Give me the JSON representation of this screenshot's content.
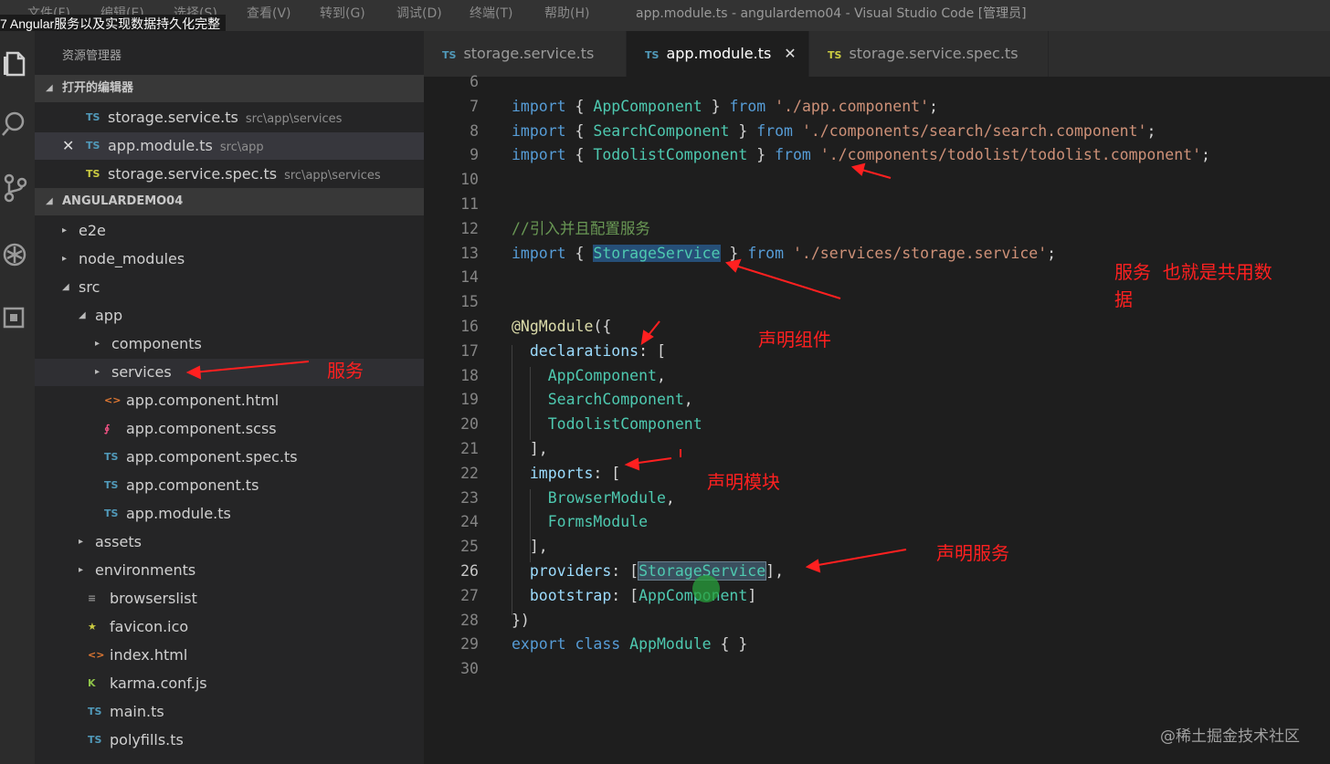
{
  "video_title": "7 Angular服务以及实现数据持久化完整",
  "titlebar": {
    "menu": [
      "文件(F)",
      "编辑(E)",
      "选择(S)",
      "查看(V)",
      "转到(G)",
      "调试(D)",
      "终端(T)",
      "帮助(H)"
    ],
    "window_title": "app.module.ts - angulardemo04 - Visual Studio Code [管理员]"
  },
  "activitybar": {
    "icons": [
      "files-icon",
      "search-icon",
      "source-control-icon",
      "debug-icon",
      "extensions-icon"
    ]
  },
  "sidebar": {
    "title": "资源管理器",
    "open_editors": {
      "header": "打开的编辑器",
      "items": [
        {
          "icon": "TS",
          "name": "storage.service.ts",
          "path": "src\\app\\services"
        },
        {
          "icon": "TS",
          "name": "app.module.ts",
          "path": "src\\app",
          "close": "✕"
        },
        {
          "icon": "TS",
          "name": "storage.service.spec.ts",
          "path": "src\\app\\services"
        }
      ]
    },
    "project": {
      "header": "ANGULARDEMO04",
      "tree": [
        {
          "name": "e2e",
          "icon": "▸",
          "indent": 0,
          "folder": true
        },
        {
          "name": "node_modules",
          "icon": "▸",
          "indent": 0,
          "folder": true
        },
        {
          "name": "src",
          "icon": "◢",
          "indent": 0,
          "folder": true
        },
        {
          "name": "app",
          "icon": "◢",
          "indent": 1,
          "folder": true
        },
        {
          "name": "components",
          "icon": "▸",
          "indent": 2,
          "folder": true
        },
        {
          "name": "services",
          "icon": "▸",
          "indent": 2,
          "folder": true
        },
        {
          "name": "app.component.html",
          "icon": "<>",
          "indent": 2
        },
        {
          "name": "app.component.scss",
          "icon": "∮",
          "indent": 2
        },
        {
          "name": "app.component.spec.ts",
          "icon": "TS",
          "indent": 2
        },
        {
          "name": "app.component.ts",
          "icon": "TS",
          "indent": 2
        },
        {
          "name": "app.module.ts",
          "icon": "TS",
          "indent": 2
        },
        {
          "name": "assets",
          "icon": "▸",
          "indent": 1,
          "folder": true
        },
        {
          "name": "environments",
          "icon": "▸",
          "indent": 1,
          "folder": true
        },
        {
          "name": "browserslist",
          "icon": "≡",
          "indent": 1
        },
        {
          "name": "favicon.ico",
          "icon": "★",
          "indent": 1
        },
        {
          "name": "index.html",
          "icon": "<>",
          "indent": 1
        },
        {
          "name": "karma.conf.js",
          "icon": "K",
          "indent": 1
        },
        {
          "name": "main.ts",
          "icon": "TS",
          "indent": 1
        },
        {
          "name": "polyfills.ts",
          "icon": "TS",
          "indent": 1
        }
      ]
    }
  },
  "tabs": [
    {
      "icon": "TS",
      "label": "storage.service.ts"
    },
    {
      "icon": "TS",
      "label": "app.module.ts",
      "close": "✕"
    },
    {
      "icon": "TS",
      "label": "storage.service.spec.ts"
    }
  ],
  "editor": {
    "lines": [
      {
        "n": "6"
      },
      {
        "n": "7",
        "t": [
          [
            "kw",
            "import"
          ],
          [
            "pu",
            " { "
          ],
          [
            "ty",
            "AppComponent"
          ],
          [
            "pu",
            " } "
          ],
          [
            "kw",
            "from"
          ],
          [
            "pu",
            " "
          ],
          [
            "st",
            "'./app.component'"
          ],
          [
            "pu",
            ";"
          ]
        ]
      },
      {
        "n": "8",
        "t": [
          [
            "kw",
            "import"
          ],
          [
            "pu",
            " { "
          ],
          [
            "ty",
            "SearchComponent"
          ],
          [
            "pu",
            " } "
          ],
          [
            "kw",
            "from"
          ],
          [
            "pu",
            " "
          ],
          [
            "st",
            "'./components/search/search.component'"
          ],
          [
            "pu",
            ";"
          ]
        ]
      },
      {
        "n": "9",
        "t": [
          [
            "kw",
            "import"
          ],
          [
            "pu",
            " { "
          ],
          [
            "ty",
            "TodolistComponent"
          ],
          [
            "pu",
            " } "
          ],
          [
            "kw",
            "from"
          ],
          [
            "pu",
            " "
          ],
          [
            "st",
            "'./components/todolist/todolist.component'"
          ],
          [
            "pu",
            ";"
          ]
        ]
      },
      {
        "n": "10"
      },
      {
        "n": "11"
      },
      {
        "n": "12",
        "t": [
          [
            "cm",
            "//引入并且配置服务"
          ]
        ]
      },
      {
        "n": "13",
        "t": [
          [
            "kw",
            "import"
          ],
          [
            "pu",
            " { "
          ],
          [
            "ty hl",
            "StorageService"
          ],
          [
            "pu",
            " } "
          ],
          [
            "kw",
            "from"
          ],
          [
            "pu",
            " "
          ],
          [
            "st",
            "'./services/storage.service'"
          ],
          [
            "pu",
            ";"
          ]
        ]
      },
      {
        "n": "14"
      },
      {
        "n": "15"
      },
      {
        "n": "16",
        "t": [
          [
            "dc",
            "@NgModule"
          ],
          [
            "pu",
            "({"
          ]
        ]
      },
      {
        "n": "17",
        "t": [
          [
            "pu",
            "  "
          ],
          [
            "pr",
            "declarations"
          ],
          [
            "pu",
            ": ["
          ]
        ]
      },
      {
        "n": "18",
        "t": [
          [
            "pu",
            "    "
          ],
          [
            "ty",
            "AppComponent"
          ],
          [
            "pu",
            ","
          ]
        ]
      },
      {
        "n": "19",
        "t": [
          [
            "pu",
            "    "
          ],
          [
            "ty",
            "SearchComponent"
          ],
          [
            "pu",
            ","
          ]
        ]
      },
      {
        "n": "20",
        "t": [
          [
            "pu",
            "    "
          ],
          [
            "ty",
            "TodolistComponent"
          ]
        ]
      },
      {
        "n": "21",
        "t": [
          [
            "pu",
            "  ],"
          ]
        ]
      },
      {
        "n": "22",
        "t": [
          [
            "pu",
            "  "
          ],
          [
            "pr",
            "imports"
          ],
          [
            "pu",
            ": ["
          ]
        ]
      },
      {
        "n": "23",
        "t": [
          [
            "pu",
            "    "
          ],
          [
            "ty",
            "BrowserModule"
          ],
          [
            "pu",
            ","
          ]
        ]
      },
      {
        "n": "24",
        "t": [
          [
            "pu",
            "    "
          ],
          [
            "ty",
            "FormsModule"
          ]
        ]
      },
      {
        "n": "25",
        "t": [
          [
            "pu",
            "  ],"
          ]
        ]
      },
      {
        "n": "26",
        "current": true,
        "t": [
          [
            "pu",
            "  "
          ],
          [
            "pr",
            "providers"
          ],
          [
            "pu",
            ": ["
          ],
          [
            "ty hl2",
            "StorageService"
          ],
          [
            "pu",
            "],"
          ]
        ]
      },
      {
        "n": "27",
        "t": [
          [
            "pu",
            "  "
          ],
          [
            "pr",
            "bootstrap"
          ],
          [
            "pu",
            ": ["
          ],
          [
            "ty",
            "AppComponent"
          ],
          [
            "pu",
            "]"
          ]
        ]
      },
      {
        "n": "28",
        "t": [
          [
            "pu",
            "})"
          ]
        ]
      },
      {
        "n": "29",
        "t": [
          [
            "kw",
            "export"
          ],
          [
            "pu",
            " "
          ],
          [
            "kw",
            "class"
          ],
          [
            "pu",
            " "
          ],
          [
            "ty",
            "AppModule"
          ],
          [
            "pu",
            " { }"
          ]
        ]
      },
      {
        "n": "30"
      }
    ]
  },
  "annotations": {
    "service_shared": "服务  也就是共用数\n据",
    "declare_components": "声明组件",
    "services_folder": "服务",
    "declare_modules": "声明模块",
    "declare_services": "声明服务"
  },
  "watermark": "@稀土掘金技术社区",
  "colors": {
    "annotation": "#ff2020",
    "keyword": "#569cd6",
    "type": "#4ec9b0",
    "string": "#ce9178",
    "comment": "#6a9955"
  }
}
